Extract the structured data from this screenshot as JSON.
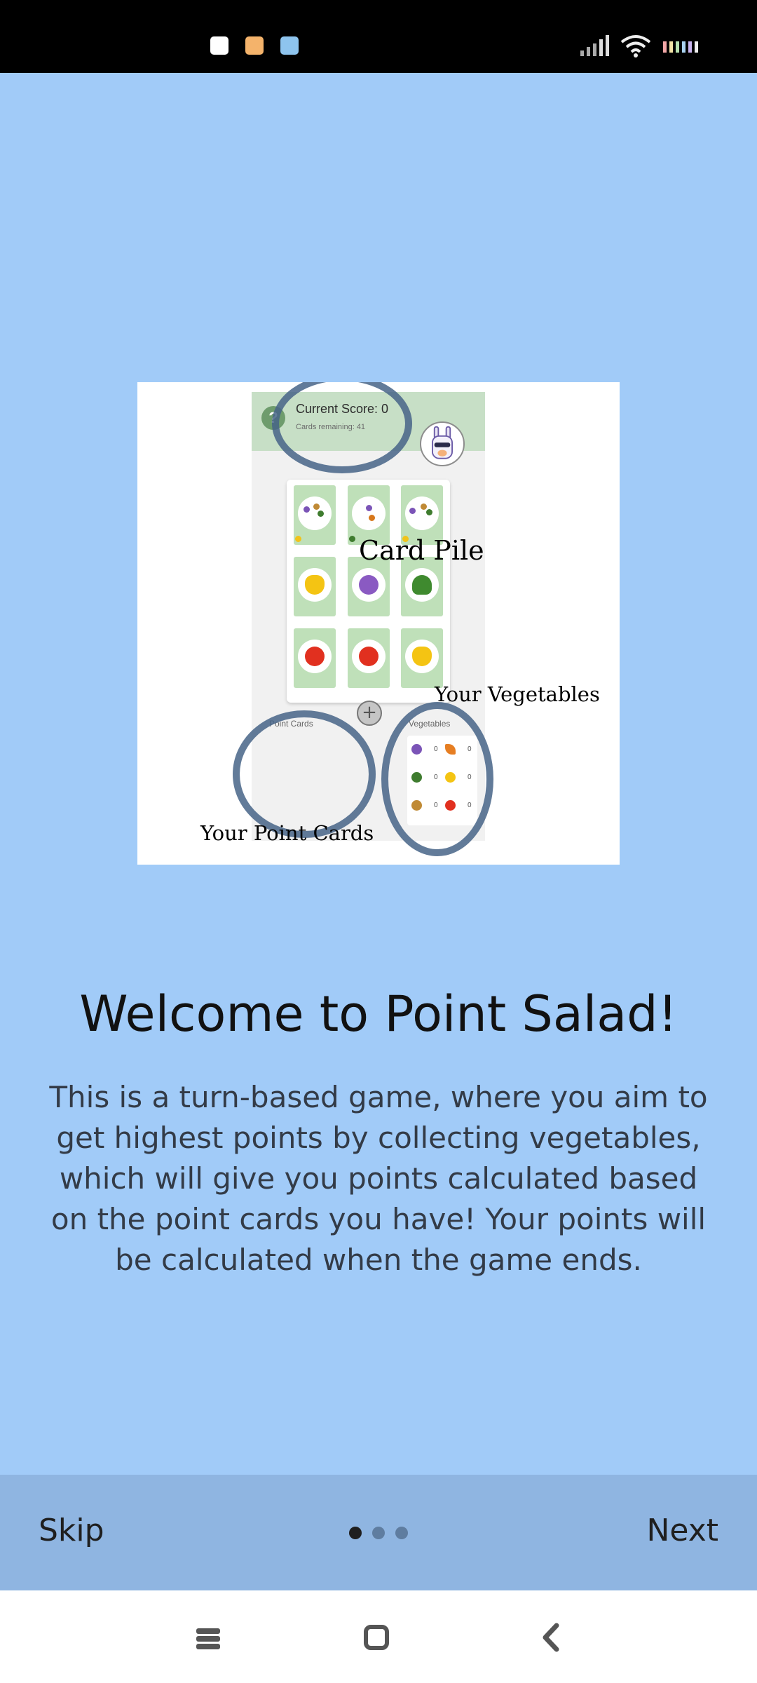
{
  "status_bar": {
    "icons": [
      "app-notification-icon",
      "message-notification-icon",
      "mail-icon",
      "signal-icon",
      "wifi-icon",
      "battery-icon"
    ]
  },
  "tutorial_image": {
    "current_score": "Current Score: 0",
    "cards_remaining": "Cards remaining: 41",
    "point_cards_label": "Point Cards",
    "vegetables_label": "Vegetables",
    "vegetable_counts": [
      "0",
      "0",
      "0",
      "0",
      "0",
      "0"
    ],
    "annotations": {
      "card_pile": "Card Pile",
      "your_vegetables": "Your Vegetables",
      "your_point_cards": "Your Point Cards"
    },
    "add_symbol": "+"
  },
  "onboarding": {
    "title": "Welcome to Point Salad!",
    "description": "This is a turn-based game, where you aim to get highest points by collecting vegetables, which will give you points calculated based on the point cards you have! Your points will be calculated when the game ends."
  },
  "footer": {
    "skip_label": "Skip",
    "next_label": "Next",
    "page_count": 3,
    "active_page": 1
  },
  "colors": {
    "background": "#a1cbf8",
    "footer": "#8fb5e1",
    "dot_active": "#1f1f1f",
    "dot_inactive": "#5f7da0"
  }
}
